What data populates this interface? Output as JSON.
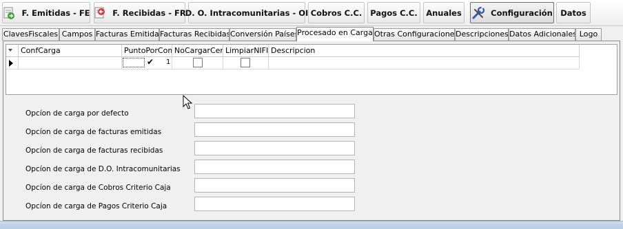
{
  "toolbar": {
    "buttons": [
      {
        "label": "F. Emitidas - FE",
        "icon": "invoice-out-icon"
      },
      {
        "label": "F. Recibidas - FR",
        "icon": "invoice-in-icon"
      },
      {
        "label": "D. O. Intracomunitarias - OI"
      },
      {
        "label": "Cobros C.C."
      },
      {
        "label": "Pagos C.C."
      },
      {
        "label": "Anuales"
      },
      {
        "label": "Configuración",
        "icon": "settings-tools-icon",
        "active": true
      },
      {
        "label": "Datos"
      }
    ]
  },
  "tabs": [
    {
      "label": "ClavesFiscales"
    },
    {
      "label": "Campos"
    },
    {
      "label": "Facturas Emitidas"
    },
    {
      "label": "Facturas Recibidas"
    },
    {
      "label": "Conversión Países"
    },
    {
      "label": "Procesado en Carga",
      "selected": true
    },
    {
      "label": "Otras Configuraciones"
    },
    {
      "label": "Descripciones"
    },
    {
      "label": "Datos Adicionales"
    },
    {
      "label": "Logo"
    }
  ],
  "grid": {
    "columns": [
      "ConfCarga",
      "PuntoPorComa",
      "NoCargarCero",
      "LimpiarNIFID",
      "Descripcion"
    ],
    "rows": [
      {
        "ConfCarga": "",
        "PuntoPorComa": true,
        "PuntoPorComa_value": "1",
        "NoCargarCero": false,
        "LimpiarNIFID": false,
        "Descripcion": ""
      }
    ]
  },
  "form": {
    "fields": [
      {
        "label": "Opcíon de carga por defecto",
        "value": ""
      },
      {
        "label": "Opcíon de carga de facturas emitidas",
        "value": ""
      },
      {
        "label": "Opcíon de carga de facturas recibidas",
        "value": ""
      },
      {
        "label": "Opcíon de carga de D.O. Intracomunitarias",
        "value": ""
      },
      {
        "label": "Opcíon de carga de Cobros Criterio Caja",
        "value": ""
      },
      {
        "label": "Opcíon de carga de Pagos Criterio Caja",
        "value": ""
      }
    ]
  },
  "colors": {
    "background": "#f0f0f0",
    "bottom_bar": "#c3d4e8",
    "header_arrow": "#2b4fa8"
  }
}
